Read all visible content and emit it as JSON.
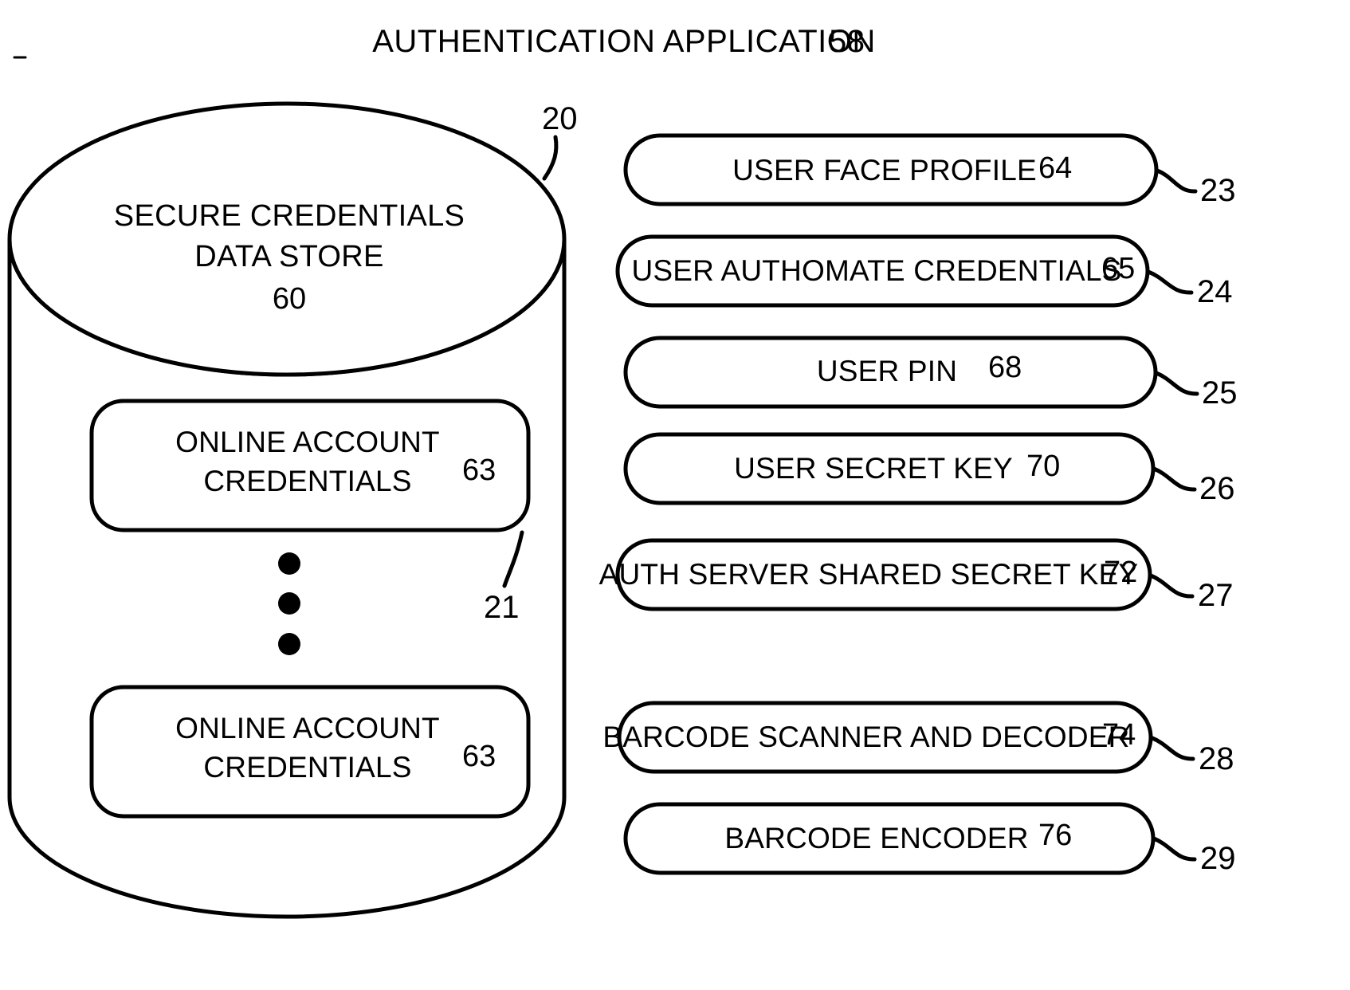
{
  "figure": {
    "title": "AUTHENTICATION APPLICATION",
    "title_ref": "58"
  },
  "data_store": {
    "label_line1": "SECURE CREDENTIALS",
    "label_line2": "DATA STORE",
    "label_ref": "60",
    "cylinder_ref": "20",
    "inner_box_leader_ref": "21",
    "ellipsis_symbol": "vertical-three-dots",
    "inner_boxes": [
      {
        "line1": "ONLINE ACCOUNT",
        "line2": "CREDENTIALS",
        "ref": "63"
      },
      {
        "line1": "ONLINE ACCOUNT",
        "line2": "CREDENTIALS",
        "ref": "63"
      }
    ]
  },
  "components": [
    {
      "label": "USER FACE PROFILE",
      "ref": "64",
      "leader_ref": "23"
    },
    {
      "label": "USER AUTHOMATE CREDENTIALS",
      "ref": "65",
      "leader_ref": "24"
    },
    {
      "label": "USER PIN",
      "ref": "68",
      "leader_ref": "25"
    },
    {
      "label": "USER SECRET KEY",
      "ref": "70",
      "leader_ref": "26"
    },
    {
      "label": "AUTH SERVER SHARED SECRET KEY",
      "ref": "72",
      "leader_ref": "27"
    },
    {
      "label": "BARCODE SCANNER AND DECODER",
      "ref": "74",
      "leader_ref": "28"
    },
    {
      "label": "BARCODE ENCODER",
      "ref": "76",
      "leader_ref": "29"
    }
  ],
  "colors": {
    "ink": "#000000",
    "paper": "#ffffff"
  }
}
